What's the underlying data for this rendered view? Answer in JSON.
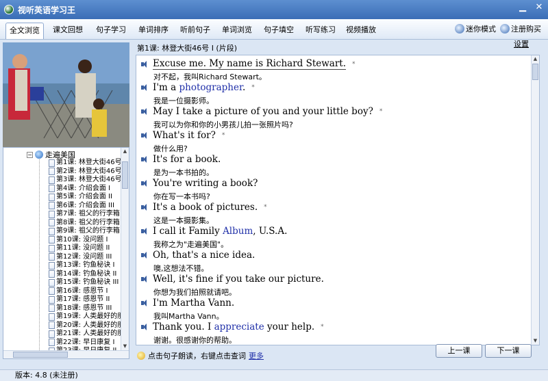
{
  "window": {
    "title": "视听英语学习王"
  },
  "tabs": [
    "全文浏览",
    "课文回想",
    "句子学习",
    "单词排序",
    "听前句子",
    "单词浏览",
    "句子填空",
    "听写练习",
    "视频播放"
  ],
  "toolbar": {
    "mini_mode": "迷你模式",
    "register": "注册购买"
  },
  "settings_link": "设置",
  "lesson_header": "第1课: 林登大街46号 I (片段)",
  "tree": {
    "root": "走遍美国",
    "items": [
      "第1课: 林登大街46号",
      "第2课: 林登大街46号",
      "第3课: 林登大街46号",
      "第4课: 介绍会面 I",
      "第5课: 介绍会面 II",
      "第6课: 介绍会面 III",
      "第7课: 祖父的行李箱",
      "第8课: 祖父的行李箱",
      "第9课: 祖父的行李箱",
      "第10课: 没问题 I",
      "第11课: 没问题 II",
      "第12课: 没问题 III",
      "第13课: 钓鱼秘诀 I",
      "第14课: 钓鱼秘诀 II",
      "第15课: 钓鱼秘诀 III",
      "第16课: 感恩节 I",
      "第17课: 感恩节 II",
      "第18课: 感恩节 III",
      "第19课: 人类最好的朋",
      "第20课: 人类最好的朋",
      "第21课: 人类最好的朋",
      "第22课: 早日康复 I",
      "第23课: 早日康复 II"
    ]
  },
  "sentences": [
    {
      "pre": "Excuse me. My name is Richard Stewart.",
      "hl": "",
      "post": "",
      "star": "*",
      "zh": "对不起，我叫Richard Stewart。"
    },
    {
      "pre": "I'm a ",
      "hl": "photographer",
      "post": ".",
      "star": "*",
      "zh": "我是一位摄影师。"
    },
    {
      "pre": "May I take a picture of you and your little boy?",
      "hl": "",
      "post": "",
      "star": "*",
      "zh": "我可以为你和你的小男孩儿拍一张照片吗?"
    },
    {
      "pre": "What's it for?",
      "hl": "",
      "post": "",
      "star": "*",
      "zh": "做什么用?"
    },
    {
      "pre": "It's for a book.",
      "hl": "",
      "post": "",
      "star": "",
      "zh": "是为一本书拍的。"
    },
    {
      "pre": "You're writing a book?",
      "hl": "",
      "post": "",
      "star": "",
      "zh": "你在写一本书吗?"
    },
    {
      "pre": "It's a book of pictures.",
      "hl": "",
      "post": "",
      "star": "*",
      "zh": "这是一本摄影集。"
    },
    {
      "pre": "I call it Family ",
      "hl": "Album",
      "post": ", U.S.A.",
      "star": "",
      "zh": "我称之为\"走遍美国\"。"
    },
    {
      "pre": "Oh, that's a nice idea.",
      "hl": "",
      "post": "",
      "star": "",
      "zh": "噢,这想法不错。"
    },
    {
      "pre": "Well, it's fine if you take our picture.",
      "hl": "",
      "post": "",
      "star": "",
      "zh": "你想为我们拍照就请吧。"
    },
    {
      "pre": "I'm Martha Vann.",
      "hl": "",
      "post": "",
      "star": "",
      "zh": "我叫Martha Vann。"
    },
    {
      "pre": "Thank you. I ",
      "hl": "appreciate",
      "post": " your help.",
      "star": "*",
      "zh": "谢谢。很感谢你的帮助。"
    }
  ],
  "hint": {
    "text": "点击句子朗读，右键点击查词",
    "more": "更多"
  },
  "buttons": {
    "prev": "上一课",
    "next": "下一课"
  },
  "status": {
    "version": "版本: 4.8  (未注册)"
  }
}
